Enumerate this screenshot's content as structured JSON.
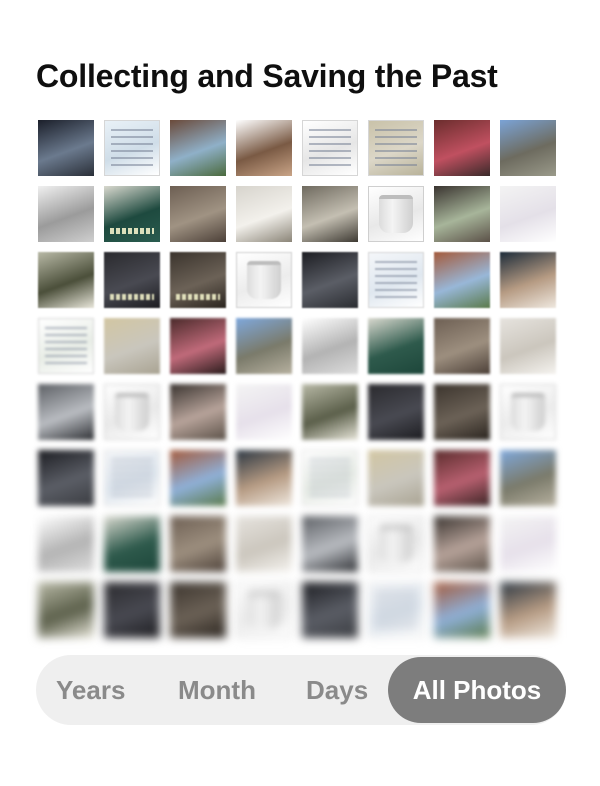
{
  "page": {
    "title": "Collecting and Saving the Past"
  },
  "grid": {
    "rows": 8,
    "columns": 8,
    "photos": [
      {
        "kind": "photo",
        "colors": [
          "#1b1f2a",
          "#6b7a8e",
          "#2a2f38"
        ]
      },
      {
        "kind": "doc",
        "colors": [
          "#e9f1f7",
          "#cfdde8",
          "#ffffff"
        ]
      },
      {
        "kind": "photo",
        "colors": [
          "#6a4a3a",
          "#8fb0c8",
          "#4b6a3d"
        ]
      },
      {
        "kind": "photo",
        "colors": [
          "#ffffff",
          "#7a5a44",
          "#c9a487"
        ]
      },
      {
        "kind": "doc",
        "colors": [
          "#ffffff",
          "#e6e6e6",
          "#ffffff"
        ]
      },
      {
        "kind": "doc",
        "colors": [
          "#c9c2a9",
          "#dcd7c8",
          "#b9b39a"
        ]
      },
      {
        "kind": "photo",
        "colors": [
          "#6b2d2d",
          "#c05060",
          "#3a2a2a"
        ]
      },
      {
        "kind": "photo",
        "colors": [
          "#7ba3d6",
          "#6d6b5f",
          "#9a9a8a"
        ]
      },
      {
        "kind": "photo",
        "colors": [
          "#f0f0f0",
          "#9b9b9b",
          "#cfcfcf"
        ]
      },
      {
        "kind": "caption",
        "colors": [
          "#d9d9cf",
          "#1e4a3f",
          "#2a5c4f"
        ]
      },
      {
        "kind": "photo",
        "colors": [
          "#6d5f53",
          "#a09383",
          "#4c4038"
        ]
      },
      {
        "kind": "photo",
        "colors": [
          "#d7d4cd",
          "#f3f1ec",
          "#8b8578"
        ]
      },
      {
        "kind": "photo",
        "colors": [
          "#6f6a5f",
          "#c4bfb2",
          "#3e3a33"
        ]
      },
      {
        "kind": "can",
        "colors": [
          "#ffffff",
          "#e8e8e8",
          "#ffffff"
        ]
      },
      {
        "kind": "photo",
        "colors": [
          "#3a3430",
          "#a7b59a",
          "#5b5148"
        ]
      },
      {
        "kind": "photo",
        "colors": [
          "#f3f3f3",
          "#e4e0e8",
          "#ffffff"
        ]
      },
      {
        "kind": "photo",
        "colors": [
          "#b8b9a6",
          "#4b4f3a",
          "#e8e6da"
        ]
      },
      {
        "kind": "caption",
        "colors": [
          "#2a2a2e",
          "#494a52",
          "#1c1c20"
        ]
      },
      {
        "kind": "caption",
        "colors": [
          "#3b342d",
          "#6c6257",
          "#2a241e"
        ]
      },
      {
        "kind": "can",
        "colors": [
          "#ffffff",
          "#ececec",
          "#ffffff"
        ]
      },
      {
        "kind": "photo",
        "colors": [
          "#1c1d22",
          "#5b5e66",
          "#2a2c31"
        ]
      },
      {
        "kind": "doc",
        "colors": [
          "#f4f6f9",
          "#dfe7ef",
          "#ffffff"
        ]
      },
      {
        "kind": "photo",
        "colors": [
          "#a45a3b",
          "#98b7d8",
          "#5a7a4a"
        ]
      },
      {
        "kind": "photo",
        "colors": [
          "#1d2c3a",
          "#b69b83",
          "#efe8df"
        ]
      },
      {
        "kind": "doc",
        "colors": [
          "#ffffff",
          "#e8ede6",
          "#ffffff"
        ]
      },
      {
        "kind": "photo",
        "colors": [
          "#d2c6a2",
          "#c9c6bd",
          "#a9a392"
        ]
      },
      {
        "kind": "photo",
        "colors": [
          "#4a2a2a",
          "#c06a7a",
          "#2a1c1c"
        ]
      },
      {
        "kind": "photo",
        "colors": [
          "#7fa8dc",
          "#7a7a6a",
          "#b7b1a0"
        ]
      },
      {
        "kind": "photo",
        "colors": [
          "#ffffff",
          "#b3b3b3",
          "#dddddd"
        ]
      },
      {
        "kind": "photo",
        "colors": [
          "#d9d9cf",
          "#2e5a4c",
          "#1d463a"
        ]
      },
      {
        "kind": "photo",
        "colors": [
          "#6d5f53",
          "#9d8f7f",
          "#4c4038"
        ]
      },
      {
        "kind": "photo",
        "colors": [
          "#e6e3de",
          "#cbc6bd",
          "#f5f3ef"
        ]
      },
      {
        "kind": "photo",
        "colors": [
          "#5d6065",
          "#b9bcc1",
          "#2e3034"
        ]
      },
      {
        "kind": "can",
        "colors": [
          "#ffffff",
          "#e9e9e9",
          "#ffffff"
        ]
      },
      {
        "kind": "photo",
        "colors": [
          "#3a3430",
          "#b7a39a",
          "#5b5148"
        ]
      },
      {
        "kind": "photo",
        "colors": [
          "#f4f4f4",
          "#e6e0ea",
          "#ffffff"
        ]
      },
      {
        "kind": "photo",
        "colors": [
          "#b8b9a6",
          "#5b5f4a",
          "#e8e6da"
        ]
      },
      {
        "kind": "photo",
        "colors": [
          "#2a2a2e",
          "#494a52",
          "#1c1c20"
        ]
      },
      {
        "kind": "photo",
        "colors": [
          "#3b342d",
          "#6c6257",
          "#2a241e"
        ]
      },
      {
        "kind": "can",
        "colors": [
          "#ffffff",
          "#ececec",
          "#ffffff"
        ]
      },
      {
        "kind": "photo",
        "colors": [
          "#1c1d22",
          "#5b5e66",
          "#3a3c41"
        ]
      },
      {
        "kind": "doc",
        "colors": [
          "#f4f6f9",
          "#dfe7ef",
          "#ffffff"
        ]
      },
      {
        "kind": "photo",
        "colors": [
          "#a45a3b",
          "#8fb0d8",
          "#5a7a4a"
        ]
      },
      {
        "kind": "photo",
        "colors": [
          "#2a3642",
          "#b69b83",
          "#efe8df"
        ]
      },
      {
        "kind": "doc",
        "colors": [
          "#ffffff",
          "#e8ede6",
          "#ffffff"
        ]
      },
      {
        "kind": "photo",
        "colors": [
          "#d2c6a2",
          "#c9c6bd",
          "#a9a392"
        ]
      },
      {
        "kind": "photo",
        "colors": [
          "#5a2c2c",
          "#b86070",
          "#3a2424"
        ]
      },
      {
        "kind": "photo",
        "colors": [
          "#7fa8dc",
          "#7a7a6a",
          "#b7b1a0"
        ]
      },
      {
        "kind": "photo",
        "colors": [
          "#ffffff",
          "#b3b3b3",
          "#dddddd"
        ]
      },
      {
        "kind": "photo",
        "colors": [
          "#d9d9cf",
          "#2e5a4c",
          "#1d463a"
        ]
      },
      {
        "kind": "photo",
        "colors": [
          "#6d5f53",
          "#9d8f7f",
          "#4c4038"
        ]
      },
      {
        "kind": "photo",
        "colors": [
          "#e6e3de",
          "#cbc6bd",
          "#f5f3ef"
        ]
      },
      {
        "kind": "photo",
        "colors": [
          "#5d6065",
          "#b9bcc1",
          "#2e3034"
        ]
      },
      {
        "kind": "can",
        "colors": [
          "#ffffff",
          "#e9e9e9",
          "#ffffff"
        ]
      },
      {
        "kind": "photo",
        "colors": [
          "#3a3430",
          "#b7a39a",
          "#5b5148"
        ]
      },
      {
        "kind": "photo",
        "colors": [
          "#f4f4f4",
          "#e6e0ea",
          "#ffffff"
        ]
      },
      {
        "kind": "photo",
        "colors": [
          "#b8b9a6",
          "#5b5f4a",
          "#e8e6da"
        ]
      },
      {
        "kind": "photo",
        "colors": [
          "#2a2a2e",
          "#494a52",
          "#1c1c20"
        ]
      },
      {
        "kind": "photo",
        "colors": [
          "#3b342d",
          "#6c6257",
          "#2a241e"
        ]
      },
      {
        "kind": "can",
        "colors": [
          "#ffffff",
          "#ececec",
          "#ffffff"
        ]
      },
      {
        "kind": "photo",
        "colors": [
          "#1c1d22",
          "#5b5e66",
          "#3a3c41"
        ]
      },
      {
        "kind": "doc",
        "colors": [
          "#f4f6f9",
          "#dfe7ef",
          "#ffffff"
        ]
      },
      {
        "kind": "photo",
        "colors": [
          "#a45a3b",
          "#8fb0d8",
          "#5a7a4a"
        ]
      },
      {
        "kind": "photo",
        "colors": [
          "#2a3642",
          "#b69b83",
          "#efe8df"
        ]
      }
    ]
  },
  "segmented_control": {
    "items": [
      "Years",
      "Month",
      "Days"
    ],
    "active": "All Photos"
  },
  "colors": {
    "title": "#0f0f0f",
    "segment_track": "#efefef",
    "segment_text": "#8a8a8a",
    "segment_active_bg": "#7d7d7d",
    "segment_active_text": "#ffffff"
  }
}
